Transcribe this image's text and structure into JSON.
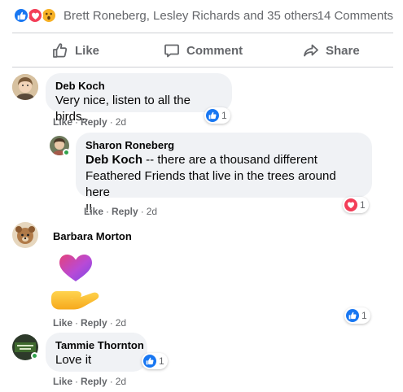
{
  "reaction_summary": {
    "names": "Brett Roneberg, Lesley Richards and 35 others",
    "comments_count": "14 Comments",
    "reactions": [
      "like-icon",
      "love-icon",
      "wow-icon"
    ]
  },
  "actions": {
    "like": "Like",
    "comment": "Comment",
    "share": "Share"
  },
  "comments": [
    {
      "author": "Deb Koch",
      "text": "Very nice, listen to all the birds..",
      "like_label": "Like",
      "reply_label": "Reply",
      "age": "2d",
      "reaction_count": "1",
      "reaction_icon": "like-icon"
    },
    {
      "author": "Sharon Roneberg",
      "mention": "Deb Koch",
      "text_line1": " -- there are a thousand different",
      "text_line2": "Feathered Friends that live in the trees around here",
      "text_line3": "!!",
      "like_label": "Like",
      "reply_label": "Reply",
      "age": "2d",
      "reaction_count": "1",
      "reaction_icon": "love-icon"
    },
    {
      "author": "Barbara Morton",
      "sticker": "heart-in-hand-sticker",
      "like_label": "Like",
      "reply_label": "Reply",
      "age": "2d",
      "reaction_count": "1",
      "reaction_icon": "like-icon"
    },
    {
      "author": "Tammie Thornton",
      "text": "Love it",
      "like_label": "Like",
      "reply_label": "Reply",
      "age": "2d",
      "reaction_count": "1",
      "reaction_icon": "like-icon"
    }
  ],
  "colors": {
    "like_blue": "#1877f2",
    "love_red": "#f33e58",
    "wow_yellow": "#f7b125",
    "secondary_text": "#65676b",
    "bubble_bg": "#f0f2f5"
  }
}
